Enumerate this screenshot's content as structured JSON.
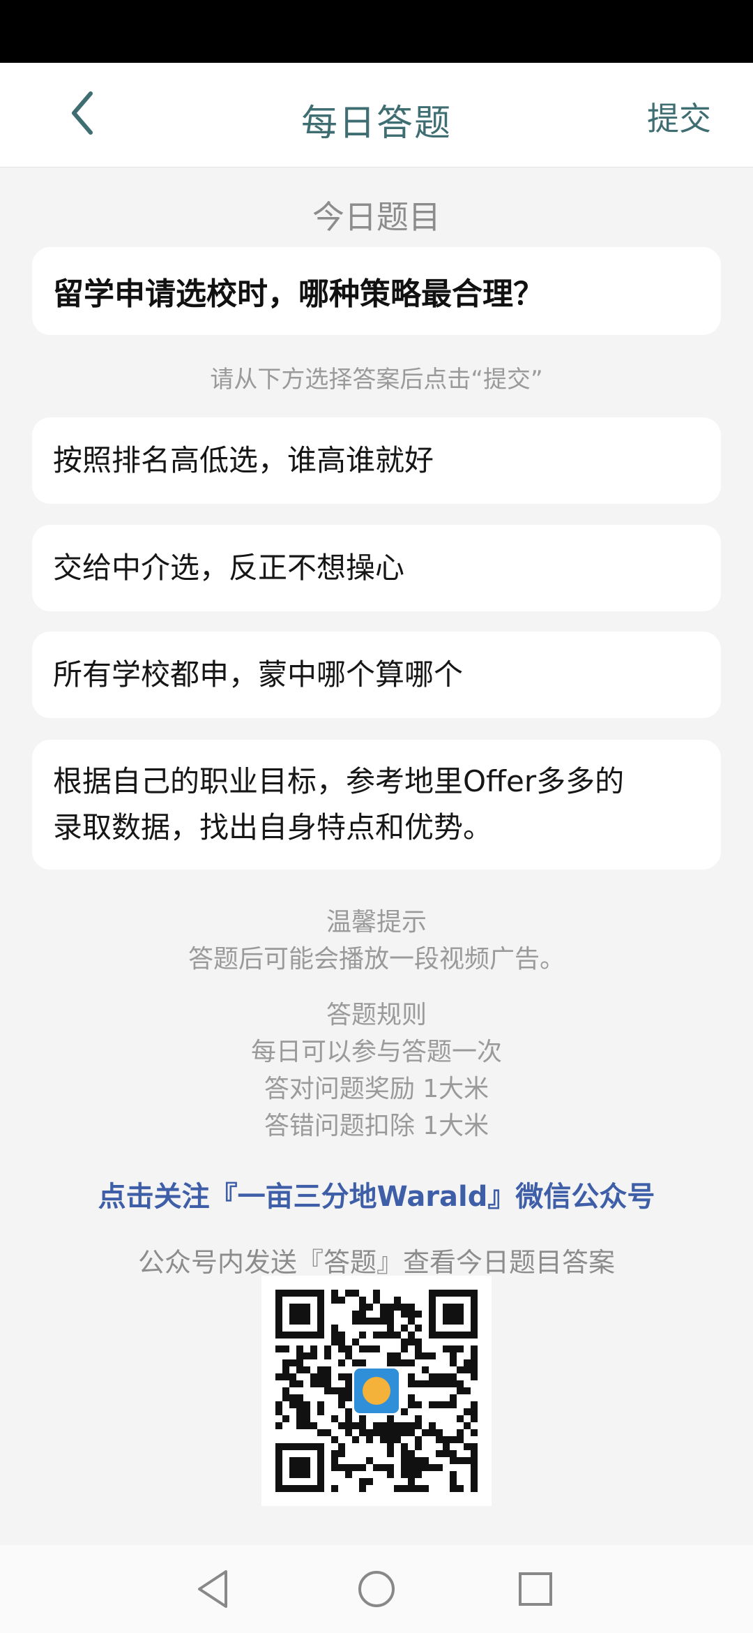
{
  "header": {
    "title": "每日答题",
    "submit_label": "提交"
  },
  "section_label": "今日题目",
  "question": "留学申请选校时，哪种策略最合理？",
  "hint": "请从下方选择答案后点击“提交”",
  "options": [
    {
      "text": "按照排名高低选，谁高谁就好"
    },
    {
      "text": "交给中介选，反正不想操心"
    },
    {
      "text": "所有学校都申，蒙中哪个算哪个"
    },
    {
      "line1": "根据自己的职业目标，参考地里Offer多多的",
      "line2": "录取数据，找出自身特点和优势。"
    }
  ],
  "tips": {
    "title": "温馨提示",
    "text": "答题后可能会播放一段视频广告。"
  },
  "rules": {
    "title": "答题规则",
    "lines": [
      "每日可以参与答题一次",
      "答对问题奖励 1大米",
      "答错问题扣除 1大米"
    ]
  },
  "follow_link": "点击关注『一亩三分地Warald』微信公众号",
  "send_tip": "公众号内发送『答题』查看今日题目答案",
  "colors": {
    "accent": "#3f6e72",
    "link": "#3e5ea8",
    "background": "#f4f4f4"
  },
  "icons": {
    "back": "chevron-left-icon",
    "qr": "qr-code",
    "nav": [
      "nav-back-icon",
      "nav-home-icon",
      "nav-recents-icon"
    ]
  }
}
